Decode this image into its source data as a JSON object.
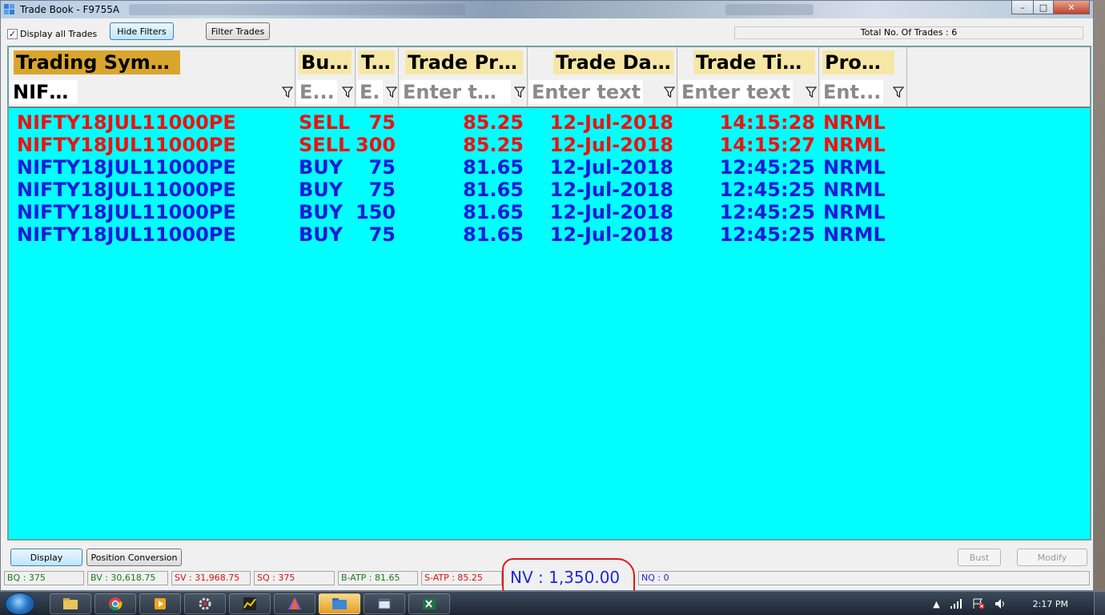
{
  "window": {
    "title": "Trade Book - F9755A",
    "controls": [
      "minimize",
      "maximize",
      "close"
    ]
  },
  "toolbar": {
    "display_all_label": "Display all Trades",
    "display_all_checked": true,
    "hide_filters_label": "Hide Filters",
    "filter_trades_label": "Filter Trades",
    "total_trades": "Total No. Of Trades : 6"
  },
  "grid": {
    "columns": [
      {
        "header": "Trading Symbol",
        "filter": "NIFTY",
        "filter_filled": true
      },
      {
        "header": "Buy/Sell",
        "filter": "E...",
        "filter_filled": false
      },
      {
        "header": "T...",
        "filter": "E.",
        "filter_filled": false
      },
      {
        "header": "Trade Price",
        "filter": "Enter text",
        "filter_filled": false
      },
      {
        "header": "Trade Date",
        "filter": "Enter text",
        "filter_filled": false
      },
      {
        "header": "Trade Time",
        "filter": "Enter text",
        "filter_filled": false
      },
      {
        "header": "Product",
        "filter": "Ent...",
        "filter_filled": false
      }
    ],
    "rows": [
      {
        "symbol": "NIFTY18JUL11000PE",
        "side": "SELL",
        "qty": "75",
        "price": "85.25",
        "date": "12-Jul-2018",
        "time": "14:15:28",
        "product": "NRML",
        "color": "#ee1111"
      },
      {
        "symbol": "NIFTY18JUL11000PE",
        "side": "SELL",
        "qty": "300",
        "price": "85.25",
        "date": "12-Jul-2018",
        "time": "14:15:27",
        "product": "NRML",
        "color": "#ee1111"
      },
      {
        "symbol": "NIFTY18JUL11000PE",
        "side": "BUY",
        "qty": "75",
        "price": "81.65",
        "date": "12-Jul-2018",
        "time": "12:45:25",
        "product": "NRML",
        "color": "#1a1ad8"
      },
      {
        "symbol": "NIFTY18JUL11000PE",
        "side": "BUY",
        "qty": "75",
        "price": "81.65",
        "date": "12-Jul-2018",
        "time": "12:45:25",
        "product": "NRML",
        "color": "#1a1ad8"
      },
      {
        "symbol": "NIFTY18JUL11000PE",
        "side": "BUY",
        "qty": "150",
        "price": "81.65",
        "date": "12-Jul-2018",
        "time": "12:45:25",
        "product": "NRML",
        "color": "#1a1ad8"
      },
      {
        "symbol": "NIFTY18JUL11000PE",
        "side": "BUY",
        "qty": "75",
        "price": "81.65",
        "date": "12-Jul-2018",
        "time": "12:45:25",
        "product": "NRML",
        "color": "#1a1ad8"
      }
    ],
    "background": "#00ffff"
  },
  "bottom": {
    "display_label": "Display",
    "position_conversion_label": "Position Conversion",
    "bust_label": "Bust",
    "modify_label": "Modify",
    "stats": [
      {
        "text": "BQ : 375",
        "color": "#1a7a1a"
      },
      {
        "text": "BV : 30,618.75",
        "color": "#1a7a1a"
      },
      {
        "text": "SV : 31,968.75",
        "color": "#dd1111"
      },
      {
        "text": "SQ : 375",
        "color": "#dd1111"
      },
      {
        "text": "B-ATP : 81.65",
        "color": "#1a7a1a"
      },
      {
        "text": "S-ATP : 85.25",
        "color": "#dd1111"
      }
    ],
    "nv": "NV : 1,350.00",
    "nq": "NQ : 0"
  },
  "taskbar": {
    "apps": [
      "explorer",
      "chrome",
      "media-player",
      "gear-app",
      "chart-app",
      "prism-app",
      "folder-app",
      "window-app",
      "excel"
    ],
    "clock": "2:17 PM"
  }
}
